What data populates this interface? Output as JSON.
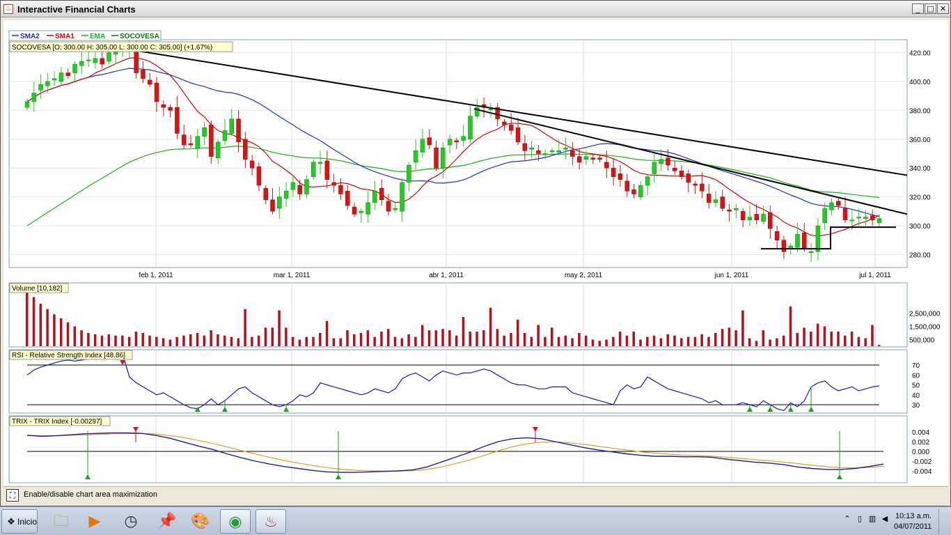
{
  "window": {
    "title": "Interactive Financial Charts",
    "app_icon": "java-icon",
    "buttons": [
      "minimize",
      "maximize",
      "close"
    ]
  },
  "legend": [
    {
      "name": "SMA2",
      "color": "#1f2fc9"
    },
    {
      "name": "SMA1",
      "color": "#d40000"
    },
    {
      "name": "EMA",
      "color": "#14b414"
    },
    {
      "name": "SOCOVESA",
      "color": "#007700"
    }
  ],
  "price_panel": {
    "info": "SOCOVESA [O: 300.00  H: 305.00  L: 300.00  C: 305.00] (+1.67%)",
    "y_ticks": [
      "420.00",
      "400.00",
      "380.00",
      "360.00",
      "340.00",
      "320.00",
      "300.00",
      "280.00"
    ],
    "x_ticks": [
      "feb 1, 2011",
      "mar 1, 2011",
      "abr 1, 2011",
      "may 2, 2011",
      "jun 1, 2011",
      "jul 1, 2011"
    ]
  },
  "volume_panel": {
    "label": "Volume [10,182]",
    "y_ticks": [
      "2,500,000",
      "1,500,000",
      "500,000"
    ]
  },
  "rsi_panel": {
    "label": "RSI - Relative Strength Index [48.86]",
    "y_ticks": [
      "70",
      "60",
      "50",
      "40",
      "30"
    ]
  },
  "trix_panel": {
    "label": "TRIX - TRIX Index [-0.00297]",
    "y_ticks": [
      "0.004",
      "0.002",
      "0.000",
      "-0.002",
      "-0.004"
    ]
  },
  "status": {
    "text": "Enable/disable chart area maximization",
    "icon": "maximize-area-icon"
  },
  "taskbar": {
    "start_label": "Inicio",
    "apps": [
      "folder-icon",
      "media-player-icon",
      "clock-app-icon",
      "pin-icon",
      "paint-icon",
      "chrome-icon",
      "java-icon"
    ],
    "clock_time": "10:13 a.m.",
    "clock_date": "04/07/2011"
  },
  "chart_data": [
    {
      "type": "candlestick",
      "title": "SOCOVESA",
      "ylim": [
        272,
        428
      ],
      "x_dates": [
        "2011-01-03",
        "2011-07-04"
      ],
      "x_tick_labels": [
        "feb 1, 2011",
        "mar 1, 2011",
        "abr 1, 2011",
        "may 2, 2011",
        "jun 1, 2011",
        "jul 1, 2011"
      ],
      "closes": [
        386,
        392,
        398,
        400,
        402,
        406,
        404,
        412,
        414,
        415,
        416,
        412,
        420,
        422,
        423,
        424,
        406,
        402,
        398,
        386,
        382,
        380,
        364,
        356,
        356,
        362,
        368,
        348,
        358,
        366,
        374,
        358,
        346,
        340,
        328,
        318,
        310,
        320,
        324,
        330,
        322,
        332,
        344,
        344,
        332,
        328,
        322,
        314,
        308,
        310,
        316,
        324,
        318,
        310,
        312,
        330,
        342,
        352,
        360,
        356,
        340,
        354,
        360,
        358,
        362,
        376,
        382,
        382,
        381,
        374,
        370,
        366,
        358,
        352,
        354,
        350,
        350,
        352,
        352,
        354,
        348,
        344,
        348,
        346,
        346,
        340,
        334,
        332,
        324,
        322,
        328,
        334,
        344,
        346,
        342,
        338,
        334,
        330,
        328,
        324,
        316,
        318,
        312,
        310,
        312,
        304,
        306,
        304,
        308,
        298,
        290,
        282,
        286,
        294,
        284,
        282,
        300,
        312,
        316,
        314,
        304,
        304,
        306,
        306,
        304,
        305
      ],
      "volume": [
        4100000,
        3700000,
        3200000,
        2800000,
        2400000,
        2100000,
        1800000,
        1500000,
        1200000,
        1000000,
        900000,
        800000,
        900000,
        800000,
        800000,
        700000,
        1100000,
        1000000,
        800000,
        700000,
        600000,
        500000,
        700000,
        800000,
        900000,
        1000000,
        800000,
        1200000,
        900000,
        800000,
        700000,
        600000,
        2800000,
        700000,
        800000,
        1400000,
        1400000,
        2700000,
        1400000,
        700000,
        500000,
        700000,
        700000,
        1000000,
        1900000,
        600000,
        600000,
        1200000,
        900000,
        1000000,
        1200000,
        700000,
        1100000,
        1300000,
        700000,
        600000,
        900000,
        700000,
        1600000,
        1200000,
        1200000,
        1300000,
        1200000,
        800000,
        2200000,
        1100000,
        1100000,
        1200000,
        2900000,
        1300000,
        800000,
        1000000,
        2000000,
        1000000,
        700000,
        1600000,
        700000,
        1400000,
        700000,
        800000,
        600000,
        1000000,
        800000,
        500000,
        400000,
        500000,
        700000,
        1100000,
        800000,
        1100000,
        500000,
        700000,
        800000,
        600000,
        900000,
        800000,
        600000,
        700000,
        700000,
        900000,
        700000,
        1000000,
        1300000,
        1400000,
        1200000,
        2700000,
        600000,
        400000,
        1200000,
        500000,
        600000,
        800000,
        3000000,
        1000000,
        1400000,
        1100000,
        1700000,
        1500000,
        1100000,
        1100000,
        800000,
        1100000,
        700000,
        600000,
        1600000,
        100000
      ],
      "rsi": [
        60,
        65,
        68,
        70,
        72,
        74,
        75,
        74,
        75,
        76,
        78,
        76,
        79,
        80,
        81,
        58,
        52,
        48,
        44,
        40,
        42,
        38,
        34,
        30,
        27,
        26,
        30,
        36,
        30,
        34,
        40,
        46,
        48,
        42,
        38,
        34,
        30,
        28,
        30,
        34,
        40,
        38,
        42,
        52,
        50,
        48,
        46,
        44,
        42,
        40,
        42,
        46,
        44,
        42,
        46,
        56,
        60,
        62,
        58,
        54,
        60,
        64,
        62,
        60,
        62,
        62,
        64,
        66,
        64,
        60,
        56,
        52,
        50,
        50,
        48,
        46,
        46,
        48,
        48,
        48,
        42,
        40,
        38,
        36,
        34,
        32,
        30,
        44,
        50,
        46,
        48,
        58,
        54,
        50,
        46,
        44,
        42,
        40,
        38,
        36,
        32,
        34,
        30,
        30,
        30,
        32,
        30,
        28,
        34,
        30,
        26,
        24,
        32,
        28,
        34,
        48,
        52,
        54,
        48,
        44,
        46,
        48,
        44,
        46,
        48,
        49
      ],
      "trix": [
        0.0033,
        0.0031,
        0.0032,
        0.0034,
        0.0036,
        0.0037,
        0.0038,
        0.0038,
        0.0037,
        0.0033,
        0.0027,
        0.0019,
        0.0011,
        0.0004,
        -0.0005,
        -0.0013,
        -0.002,
        -0.0026,
        -0.0031,
        -0.0035,
        -0.0039,
        -0.0042,
        -0.0043,
        -0.0043,
        -0.0042,
        -0.0041,
        -0.004,
        -0.0038,
        -0.0032,
        -0.0022,
        -0.0012,
        -0.0002,
        0.001,
        0.002,
        0.0026,
        0.0028,
        0.0026,
        0.002,
        0.0014,
        0.0008,
        0.0003,
        -0.0001,
        -0.0005,
        -0.0008,
        -0.001,
        -0.001,
        -0.0011,
        -0.0011,
        -0.0012,
        -0.0016,
        -0.0019,
        -0.0022,
        -0.0024,
        -0.0027,
        -0.0032,
        -0.0035,
        -0.0037,
        -0.0037,
        -0.0035,
        -0.0031,
        -0.0026
      ]
    }
  ]
}
